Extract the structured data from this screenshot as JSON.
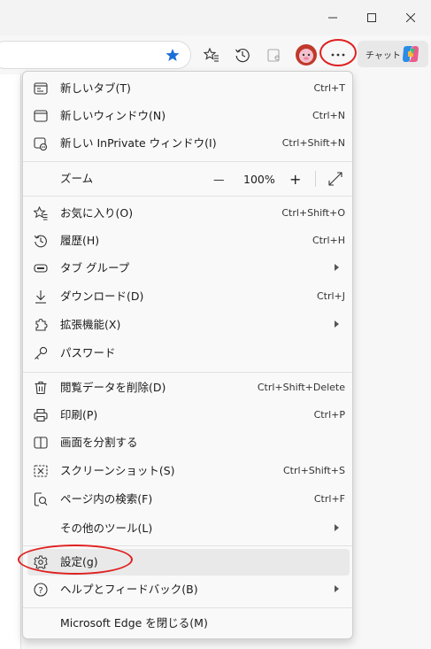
{
  "toolbar": {
    "chat_label": "チャット"
  },
  "menu": {
    "items": [
      {
        "label": "新しいタブ(T)",
        "shortcut": "Ctrl+T"
      },
      {
        "label": "新しいウィンドウ(N)",
        "shortcut": "Ctrl+N"
      },
      {
        "label": "新しい InPrivate ウィンドウ(I)",
        "shortcut": "Ctrl+Shift+N"
      },
      {
        "label": "ズーム",
        "zoom_value": "100%",
        "minus": "—",
        "plus": "+"
      },
      {
        "label": "お気に入り(O)",
        "shortcut": "Ctrl+Shift+O"
      },
      {
        "label": "履歴(H)",
        "shortcut": "Ctrl+H"
      },
      {
        "label": "タブ グループ"
      },
      {
        "label": "ダウンロード(D)",
        "shortcut": "Ctrl+J"
      },
      {
        "label": "拡張機能(X)"
      },
      {
        "label": "パスワード"
      },
      {
        "label": "閲覧データを削除(D)",
        "shortcut": "Ctrl+Shift+Delete"
      },
      {
        "label": "印刷(P)",
        "shortcut": "Ctrl+P"
      },
      {
        "label": "画面を分割する"
      },
      {
        "label": "スクリーンショット(S)",
        "shortcut": "Ctrl+Shift+S"
      },
      {
        "label": "ページ内の検索(F)",
        "shortcut": "Ctrl+F"
      },
      {
        "label": "その他のツール(L)"
      },
      {
        "label": "設定(g)"
      },
      {
        "label": "ヘルプとフィードバック(B)"
      },
      {
        "label": "Microsoft Edge を閉じる(M)"
      }
    ]
  },
  "colors": {
    "annotation": "#e02020",
    "favorite_star": "#1a6fd8",
    "menu_bg": "#f9f9f9",
    "highlight": "#e9e9e9"
  }
}
